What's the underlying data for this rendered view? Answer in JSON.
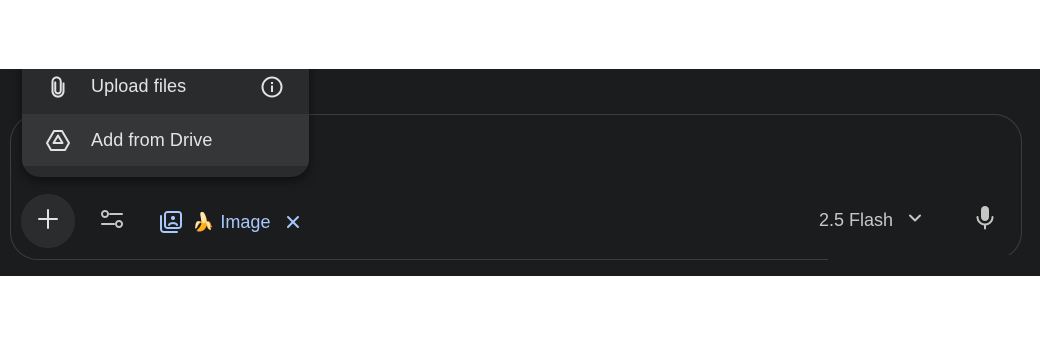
{
  "menu": {
    "items": [
      {
        "label": "Upload files",
        "icon": "paperclip-icon",
        "info_icon": "info-icon"
      },
      {
        "label": "Add from Drive",
        "icon": "drive-icon"
      }
    ]
  },
  "toolbar": {
    "plus_icon": "plus-icon",
    "tools_icon": "tune-icon",
    "image_chip": {
      "icon": "image-library-icon",
      "emoji": "🍌",
      "label": "Image",
      "close_icon": "close-icon"
    },
    "model_label": "2.5 Flash",
    "model_chevron": "chevron-down-icon",
    "mic_icon": "mic-icon"
  },
  "colors": {
    "background": "#1b1c1d",
    "menu_bg": "#2a2b2d",
    "menu_hover": "#353638",
    "accent": "#a8c7fa",
    "text": "#e3e3e3"
  }
}
